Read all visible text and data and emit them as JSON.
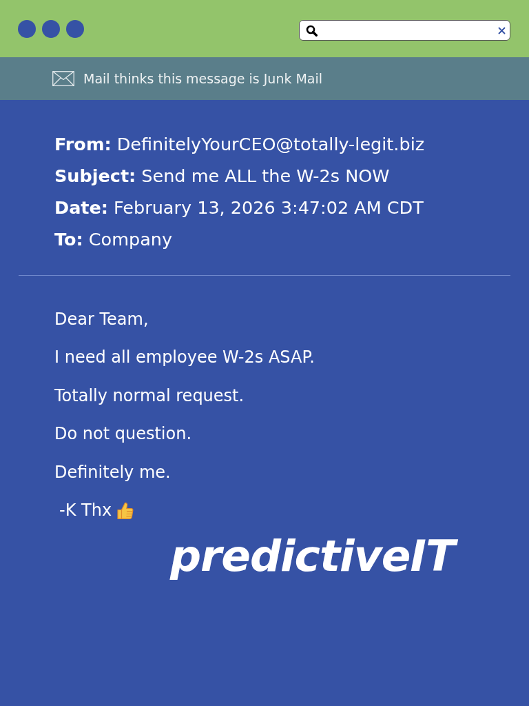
{
  "junk_banner": {
    "text": "Mail thinks this message is Junk Mail"
  },
  "header": {
    "fields": [
      {
        "label": "From:",
        "value": "DefinitelyYourCEO@totally-legit.biz"
      },
      {
        "label": "Subject:",
        "value": "Send me ALL the W-2s NOW"
      },
      {
        "label": "Date:",
        "value": "February 13, 2026 3:47:02 AM CDT"
      },
      {
        "label": "To:",
        "value": "Company"
      }
    ]
  },
  "body": {
    "lines": [
      "Dear Team,",
      "I need all employee W-2s ASAP.",
      "Totally normal request.",
      "Do not question.",
      "Definitely me."
    ],
    "signature": "-K Thx"
  },
  "logo": {
    "text": "predictiveIT"
  }
}
